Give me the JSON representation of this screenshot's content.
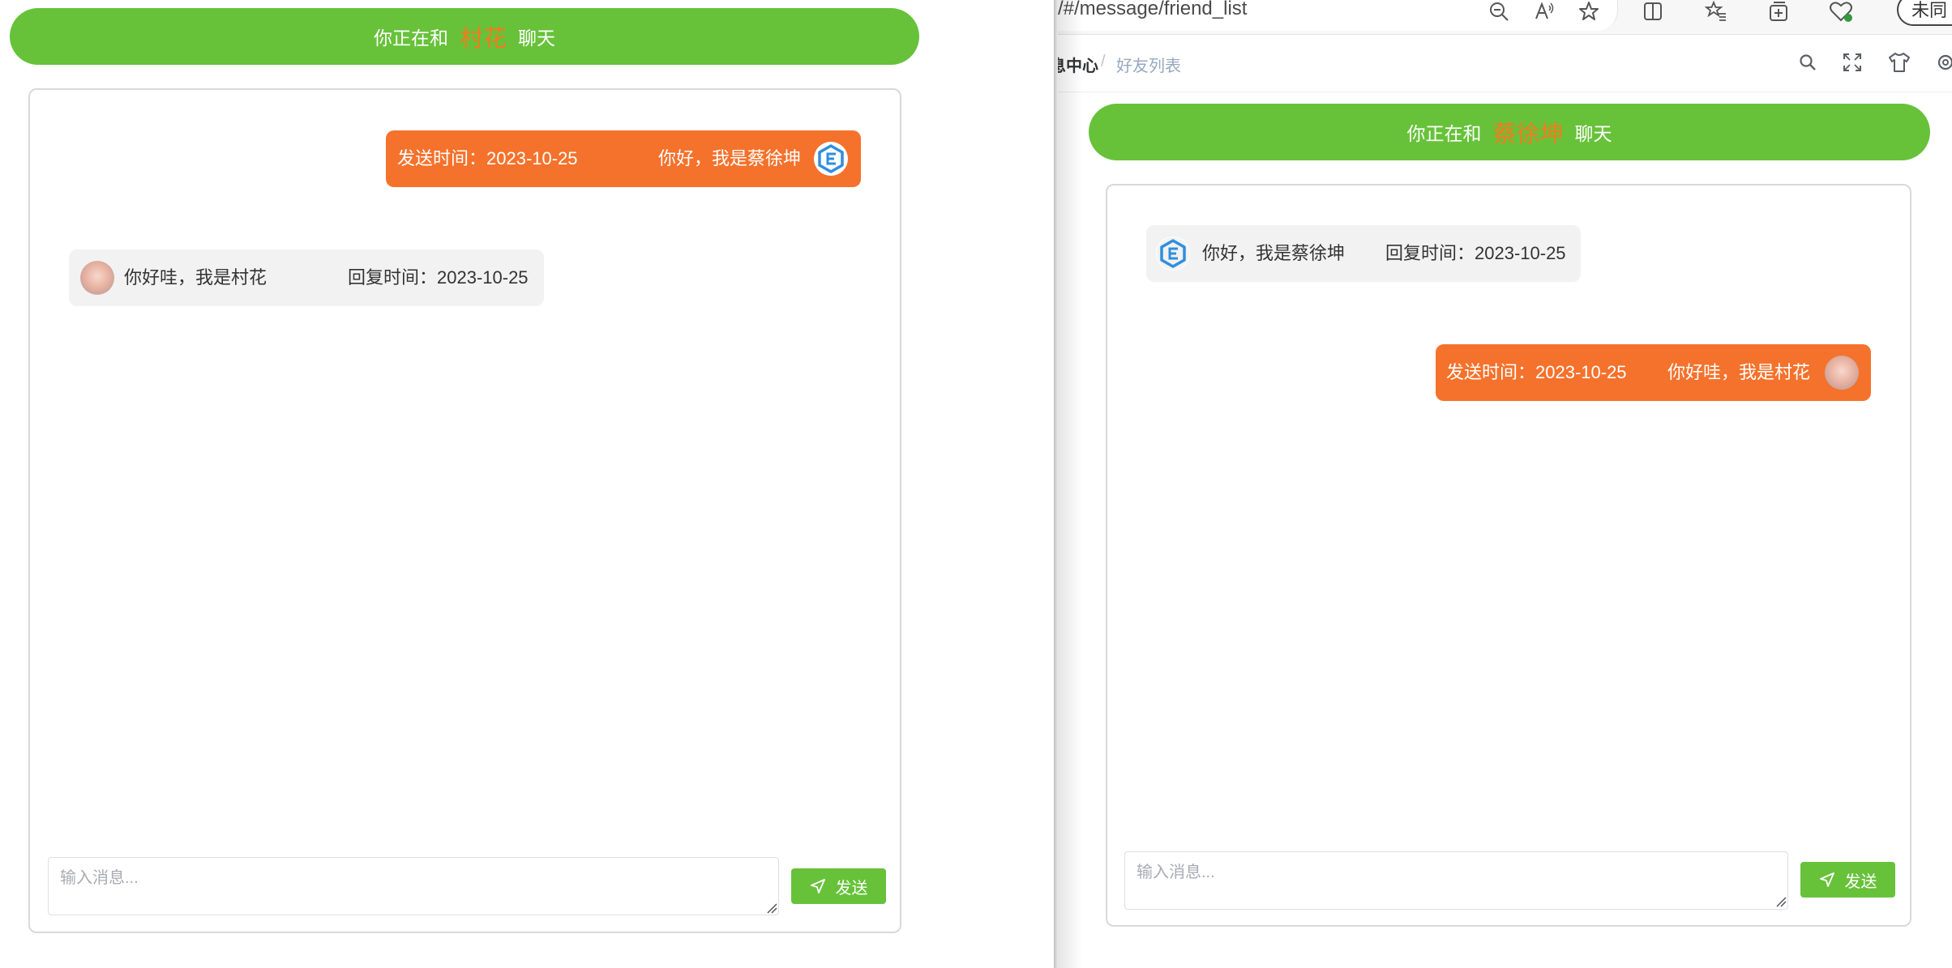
{
  "left_window": {
    "banner": {
      "prefix": "你正在和",
      "friend": "村花",
      "suffix": "聊天"
    },
    "messages": [
      {
        "kind": "sent",
        "time_label": "发送时间：2023-10-25",
        "text": "你好，我是蔡徐坤",
        "avatar_icon": "logo-avatar-icon"
      },
      {
        "kind": "received",
        "text": "你好哇，我是村花",
        "time_label": "回复时间：2023-10-25",
        "avatar_icon": "photo-avatar"
      }
    ],
    "input": {
      "placeholder": "输入消息..."
    },
    "send_button": {
      "label": "发送",
      "icon": "paper-plane-icon"
    }
  },
  "right_window": {
    "browser": {
      "url": "/#/message/friend_list",
      "sync_button": "未同"
    },
    "breadcrumb": {
      "parent": "息中心",
      "separator": "/",
      "current": "好友列表"
    },
    "banner": {
      "prefix": "你正在和",
      "friend": "蔡徐坤",
      "suffix": "聊天"
    },
    "messages": [
      {
        "kind": "received",
        "text": "你好，我是蔡徐坤",
        "time_label": "回复时间：2023-10-25",
        "avatar_icon": "logo-avatar-icon"
      },
      {
        "kind": "sent",
        "time_label": "发送时间：2023-10-25",
        "text": "你好哇，我是村花",
        "avatar_icon": "photo-avatar"
      }
    ],
    "input": {
      "placeholder": "输入消息..."
    },
    "send_button": {
      "label": "发送",
      "icon": "paper-plane-icon"
    }
  },
  "colors": {
    "banner_green": "#67c23a",
    "friend_name_orange": "#f37b1d",
    "sent_bubble": "#f5722c",
    "received_bubble": "#f2f2f2",
    "send_button": "#67c23a"
  }
}
